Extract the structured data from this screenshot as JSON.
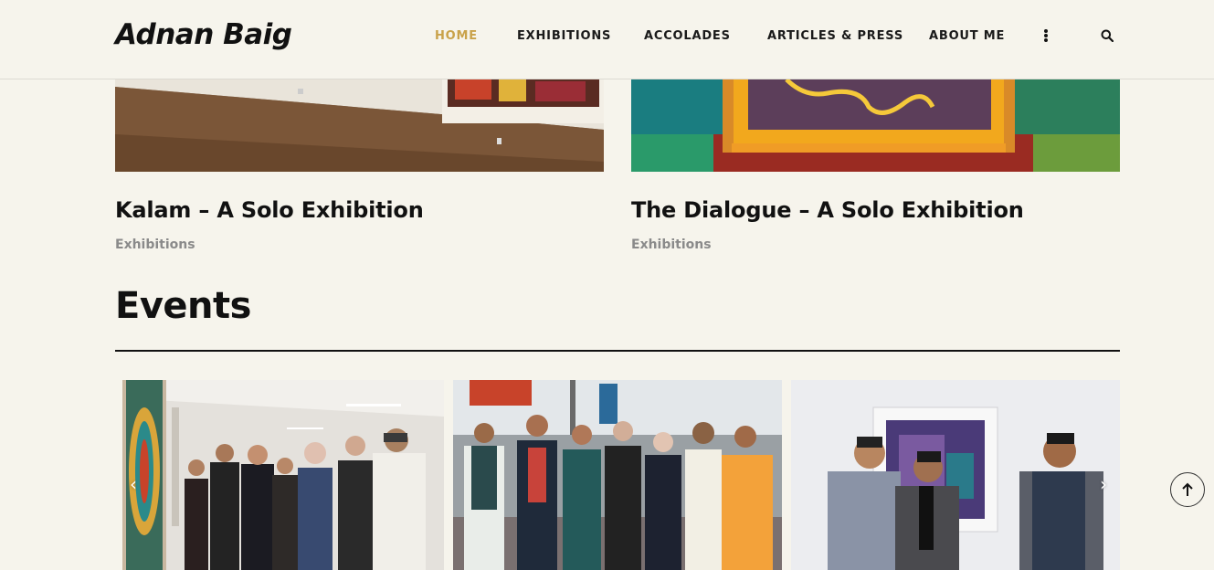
{
  "site": {
    "logo": "Adnan Baig"
  },
  "nav": {
    "items": [
      {
        "label": "HOME",
        "active": true
      },
      {
        "label": "EXHIBITIONS",
        "active": false
      },
      {
        "label": "ACCOLADES",
        "active": false
      },
      {
        "label": "ARTICLES & PRESS",
        "active": false
      },
      {
        "label": "ABOUT ME",
        "active": false
      }
    ],
    "more_icon": "vertical-dots-icon",
    "search_icon": "search-icon"
  },
  "colors": {
    "accent": "#c9a24a",
    "background": "#f6f4ec",
    "text": "#111111",
    "muted": "#8a8a8a"
  },
  "featured": [
    {
      "title": "Kalam – A Solo Exhibition",
      "category": "Exhibitions"
    },
    {
      "title": "The Dialogue – A Solo Exhibition",
      "category": "Exhibitions"
    }
  ],
  "events": {
    "title": "Events",
    "prev_icon": "chevron-left-icon",
    "next_icon": "chevron-right-icon"
  },
  "scroll_top_icon": "arrow-up-icon"
}
